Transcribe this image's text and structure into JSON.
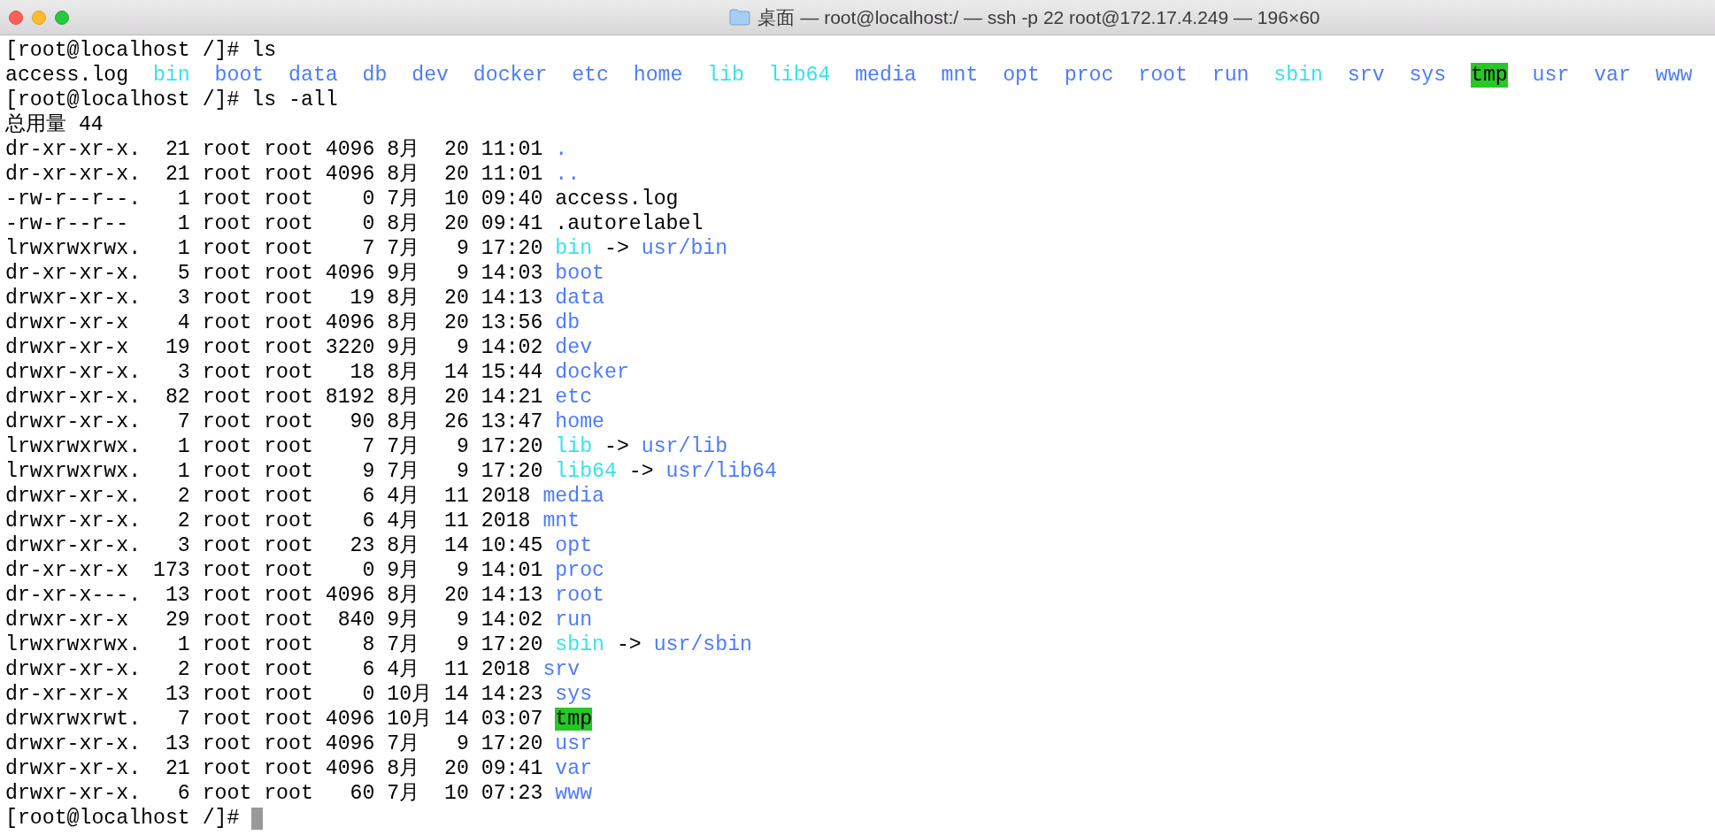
{
  "window": {
    "title": "桌面 — root@localhost:/ — ssh -p 22 root@172.17.4.249 — 196×60"
  },
  "terminal": {
    "cursor_visible": true,
    "lines": [
      {
        "segments": [
          {
            "kind": "plain",
            "text": "[root@localhost /]# ls"
          }
        ]
      },
      {
        "entries": [
          {
            "kind": "plain",
            "text": "access.log"
          },
          {
            "kind": "link",
            "text": "bin"
          },
          {
            "kind": "dir",
            "text": "boot"
          },
          {
            "kind": "dir",
            "text": "data"
          },
          {
            "kind": "dir",
            "text": "db"
          },
          {
            "kind": "dir",
            "text": "dev"
          },
          {
            "kind": "dir",
            "text": "docker"
          },
          {
            "kind": "dir",
            "text": "etc"
          },
          {
            "kind": "dir",
            "text": "home"
          },
          {
            "kind": "link",
            "text": "lib"
          },
          {
            "kind": "link",
            "text": "lib64"
          },
          {
            "kind": "dir",
            "text": "media"
          },
          {
            "kind": "dir",
            "text": "mnt"
          },
          {
            "kind": "dir",
            "text": "opt"
          },
          {
            "kind": "dir",
            "text": "proc"
          },
          {
            "kind": "dir",
            "text": "root"
          },
          {
            "kind": "dir",
            "text": "run"
          },
          {
            "kind": "link",
            "text": "sbin"
          },
          {
            "kind": "dir",
            "text": "srv"
          },
          {
            "kind": "dir",
            "text": "sys"
          },
          {
            "kind": "sticky",
            "text": "tmp"
          },
          {
            "kind": "dir",
            "text": "usr"
          },
          {
            "kind": "dir",
            "text": "var"
          },
          {
            "kind": "dir",
            "text": "www"
          }
        ]
      },
      {
        "segments": [
          {
            "kind": "plain",
            "text": "[root@localhost /]# ls -all"
          }
        ]
      },
      {
        "segments": [
          {
            "kind": "plain",
            "text": "总用量 44"
          }
        ]
      },
      {
        "segments": [
          {
            "kind": "plain",
            "text": "dr-xr-xr-x.  21 root root 4096 8月  20 11:01 "
          },
          {
            "kind": "dir",
            "text": "."
          }
        ]
      },
      {
        "segments": [
          {
            "kind": "plain",
            "text": "dr-xr-xr-x.  21 root root 4096 8月  20 11:01 "
          },
          {
            "kind": "dir",
            "text": ".."
          }
        ]
      },
      {
        "segments": [
          {
            "kind": "plain",
            "text": "-rw-r--r--.   1 root root    0 7月  10 09:40 access.log"
          }
        ]
      },
      {
        "segments": [
          {
            "kind": "plain",
            "text": "-rw-r--r--    1 root root    0 8月  20 09:41 .autorelabel"
          }
        ]
      },
      {
        "segments": [
          {
            "kind": "plain",
            "text": "lrwxrwxrwx.   1 root root    7 7月   9 17:20 "
          },
          {
            "kind": "link",
            "text": "bin"
          },
          {
            "kind": "plain",
            "text": " -> "
          },
          {
            "kind": "dir",
            "text": "usr/bin"
          }
        ]
      },
      {
        "segments": [
          {
            "kind": "plain",
            "text": "dr-xr-xr-x.   5 root root 4096 9月   9 14:03 "
          },
          {
            "kind": "dir",
            "text": "boot"
          }
        ]
      },
      {
        "segments": [
          {
            "kind": "plain",
            "text": "drwxr-xr-x.   3 root root   19 8月  20 14:13 "
          },
          {
            "kind": "dir",
            "text": "data"
          }
        ]
      },
      {
        "segments": [
          {
            "kind": "plain",
            "text": "drwxr-xr-x    4 root root 4096 8月  20 13:56 "
          },
          {
            "kind": "dir",
            "text": "db"
          }
        ]
      },
      {
        "segments": [
          {
            "kind": "plain",
            "text": "drwxr-xr-x   19 root root 3220 9月   9 14:02 "
          },
          {
            "kind": "dir",
            "text": "dev"
          }
        ]
      },
      {
        "segments": [
          {
            "kind": "plain",
            "text": "drwxr-xr-x.   3 root root   18 8月  14 15:44 "
          },
          {
            "kind": "dir",
            "text": "docker"
          }
        ]
      },
      {
        "segments": [
          {
            "kind": "plain",
            "text": "drwxr-xr-x.  82 root root 8192 8月  20 14:21 "
          },
          {
            "kind": "dir",
            "text": "etc"
          }
        ]
      },
      {
        "segments": [
          {
            "kind": "plain",
            "text": "drwxr-xr-x.   7 root root   90 8月  26 13:47 "
          },
          {
            "kind": "dir",
            "text": "home"
          }
        ]
      },
      {
        "segments": [
          {
            "kind": "plain",
            "text": "lrwxrwxrwx.   1 root root    7 7月   9 17:20 "
          },
          {
            "kind": "link",
            "text": "lib"
          },
          {
            "kind": "plain",
            "text": " -> "
          },
          {
            "kind": "dir",
            "text": "usr/lib"
          }
        ]
      },
      {
        "segments": [
          {
            "kind": "plain",
            "text": "lrwxrwxrwx.   1 root root    9 7月   9 17:20 "
          },
          {
            "kind": "link",
            "text": "lib64"
          },
          {
            "kind": "plain",
            "text": " -> "
          },
          {
            "kind": "dir",
            "text": "usr/lib64"
          }
        ]
      },
      {
        "segments": [
          {
            "kind": "plain",
            "text": "drwxr-xr-x.   2 root root    6 4月  11 2018 "
          },
          {
            "kind": "dir",
            "text": "media"
          }
        ]
      },
      {
        "segments": [
          {
            "kind": "plain",
            "text": "drwxr-xr-x.   2 root root    6 4月  11 2018 "
          },
          {
            "kind": "dir",
            "text": "mnt"
          }
        ]
      },
      {
        "segments": [
          {
            "kind": "plain",
            "text": "drwxr-xr-x.   3 root root   23 8月  14 10:45 "
          },
          {
            "kind": "dir",
            "text": "opt"
          }
        ]
      },
      {
        "segments": [
          {
            "kind": "plain",
            "text": "dr-xr-xr-x  173 root root    0 9月   9 14:01 "
          },
          {
            "kind": "dir",
            "text": "proc"
          }
        ]
      },
      {
        "segments": [
          {
            "kind": "plain",
            "text": "dr-xr-x---.  13 root root 4096 8月  20 14:13 "
          },
          {
            "kind": "dir",
            "text": "root"
          }
        ]
      },
      {
        "segments": [
          {
            "kind": "plain",
            "text": "drwxr-xr-x   29 root root  840 9月   9 14:02 "
          },
          {
            "kind": "dir",
            "text": "run"
          }
        ]
      },
      {
        "segments": [
          {
            "kind": "plain",
            "text": "lrwxrwxrwx.   1 root root    8 7月   9 17:20 "
          },
          {
            "kind": "link",
            "text": "sbin"
          },
          {
            "kind": "plain",
            "text": " -> "
          },
          {
            "kind": "dir",
            "text": "usr/sbin"
          }
        ]
      },
      {
        "segments": [
          {
            "kind": "plain",
            "text": "drwxr-xr-x.   2 root root    6 4月  11 2018 "
          },
          {
            "kind": "dir",
            "text": "srv"
          }
        ]
      },
      {
        "segments": [
          {
            "kind": "plain",
            "text": "dr-xr-xr-x   13 root root    0 10月 14 14:23 "
          },
          {
            "kind": "dir",
            "text": "sys"
          }
        ]
      },
      {
        "segments": [
          {
            "kind": "plain",
            "text": "drwxrwxrwt.   7 root root 4096 10月 14 03:07 "
          },
          {
            "kind": "sticky",
            "text": "tmp"
          }
        ]
      },
      {
        "segments": [
          {
            "kind": "plain",
            "text": "drwxr-xr-x.  13 root root 4096 7月   9 17:20 "
          },
          {
            "kind": "dir",
            "text": "usr"
          }
        ]
      },
      {
        "segments": [
          {
            "kind": "plain",
            "text": "drwxr-xr-x.  21 root root 4096 8月  20 09:41 "
          },
          {
            "kind": "dir",
            "text": "var"
          }
        ]
      },
      {
        "segments": [
          {
            "kind": "plain",
            "text": "drwxr-xr-x.   6 root root   60 7月  10 07:23 "
          },
          {
            "kind": "dir",
            "text": "www"
          }
        ]
      },
      {
        "segments": [
          {
            "kind": "plain",
            "text": "[root@localhost /]# "
          }
        ]
      }
    ]
  }
}
